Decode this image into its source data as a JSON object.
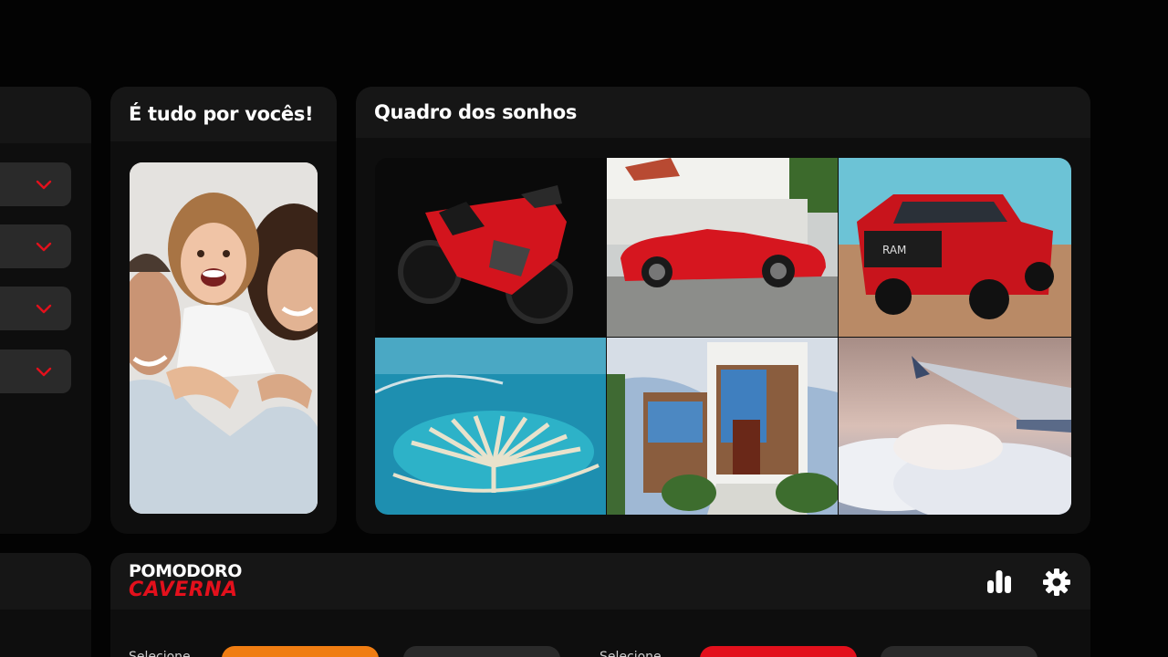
{
  "colors": {
    "accent_red": "#e3101c",
    "accent_orange": "#f07d12",
    "panel": "#0e0e0e",
    "header": "#161616",
    "dropdown": "#2a2a2a"
  },
  "family_panel": {
    "title": "É tudo por vocês!"
  },
  "dream_board": {
    "title": "Quadro dos sonhos",
    "images": [
      "red-motorcycle",
      "red-convertible",
      "red-pickup-truck",
      "palm-island",
      "modern-house",
      "airplane-wing-clouds"
    ]
  },
  "left_panel": {
    "dropdowns": [
      "chevron-down-icon",
      "chevron-down-icon",
      "chevron-down-icon",
      "chevron-down-icon"
    ]
  },
  "pomodoro": {
    "logo_top": "POMODORO",
    "logo_bottom": "CAVERNA",
    "select_label_1": "Selecione",
    "select_label_2": "Selecione",
    "icons": [
      "bar-chart-icon",
      "gear-icon"
    ]
  }
}
